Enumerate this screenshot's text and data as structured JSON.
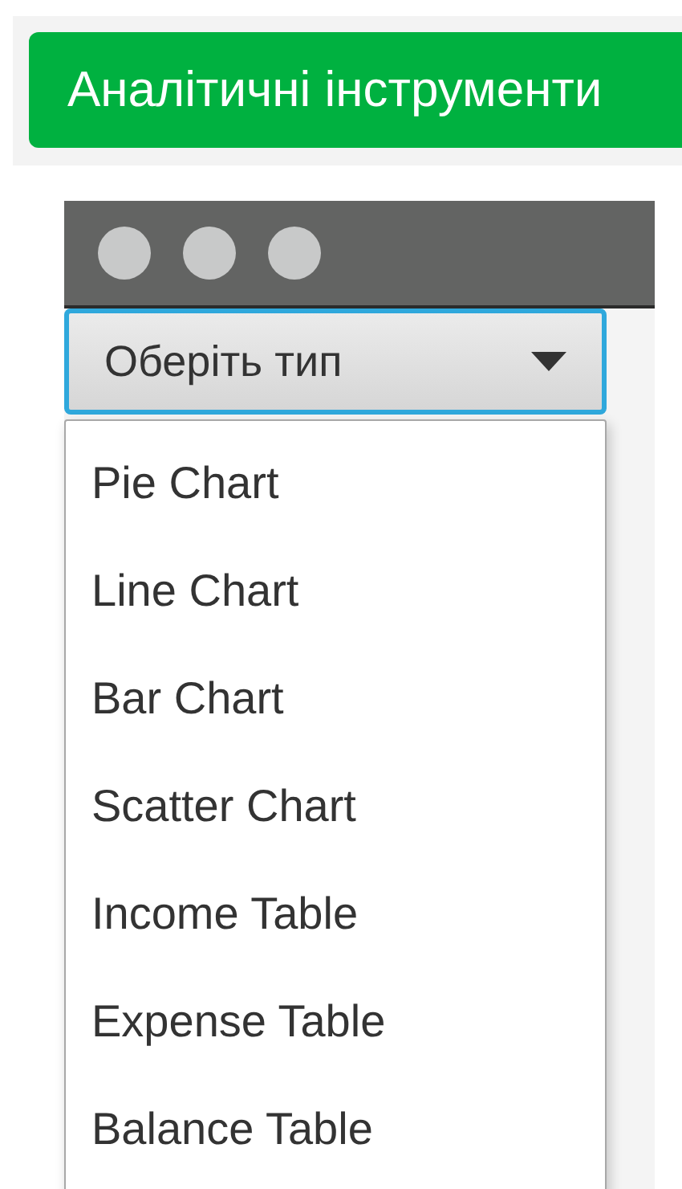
{
  "toolbar": {
    "button": "Аналітичні інструменти"
  },
  "window": {
    "combo": {
      "placeholder": "Оберіть тип",
      "focused": true,
      "expanded": true
    },
    "options": [
      {
        "label": "Pie Chart",
        "selected": false
      },
      {
        "label": "Line Chart",
        "selected": false
      },
      {
        "label": "Bar Chart",
        "selected": false
      },
      {
        "label": "Scatter Chart",
        "selected": false
      },
      {
        "label": "Income Table",
        "selected": false
      },
      {
        "label": "Expense Table",
        "selected": false
      },
      {
        "label": "Balance Table",
        "selected": false
      }
    ]
  }
}
